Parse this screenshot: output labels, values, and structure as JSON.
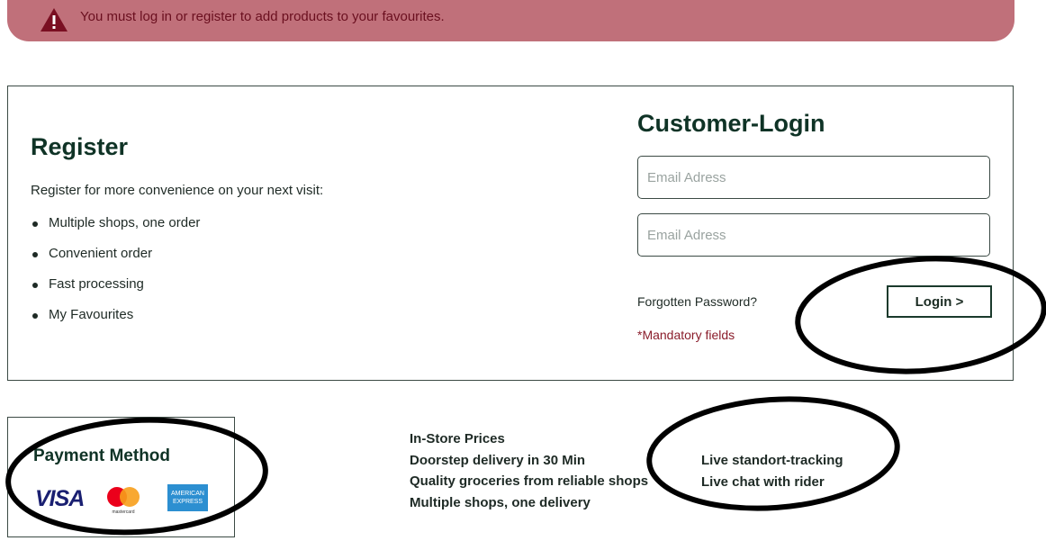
{
  "alert": {
    "message": "You must log in or register to add products to your favourites.",
    "icon": "warning-icon",
    "color": "#c0707a"
  },
  "register": {
    "title": "Register",
    "intro": "Register for more convenience on your next visit:",
    "benefits": [
      "Multiple shops, one order",
      "Convenient order",
      "Fast processing",
      "My Favourites"
    ]
  },
  "login": {
    "title": "Customer-Login",
    "email_placeholder": "Email Adress",
    "password_placeholder": "Email Adress",
    "forgot_label": "Forgotten Password?",
    "mandatory_label": "*Mandatory fields",
    "button_label": "Login >"
  },
  "payment": {
    "title": "Payment Method",
    "visa_label": "VISA",
    "mastercard_label": "mastercard",
    "amex_label": "AMERICAN EXPRESS"
  },
  "features": {
    "col1": [
      "In-Store Prices",
      "Doorstep delivery in 30 Min",
      "Quality groceries from reliable shops",
      "Multiple shops, one delivery"
    ],
    "col2": [
      "Live standort-tracking",
      "Live chat with rider"
    ]
  },
  "colors": {
    "brand_dark": "#0f3326",
    "error": "#8a1d2b",
    "annotation": "#000000"
  }
}
